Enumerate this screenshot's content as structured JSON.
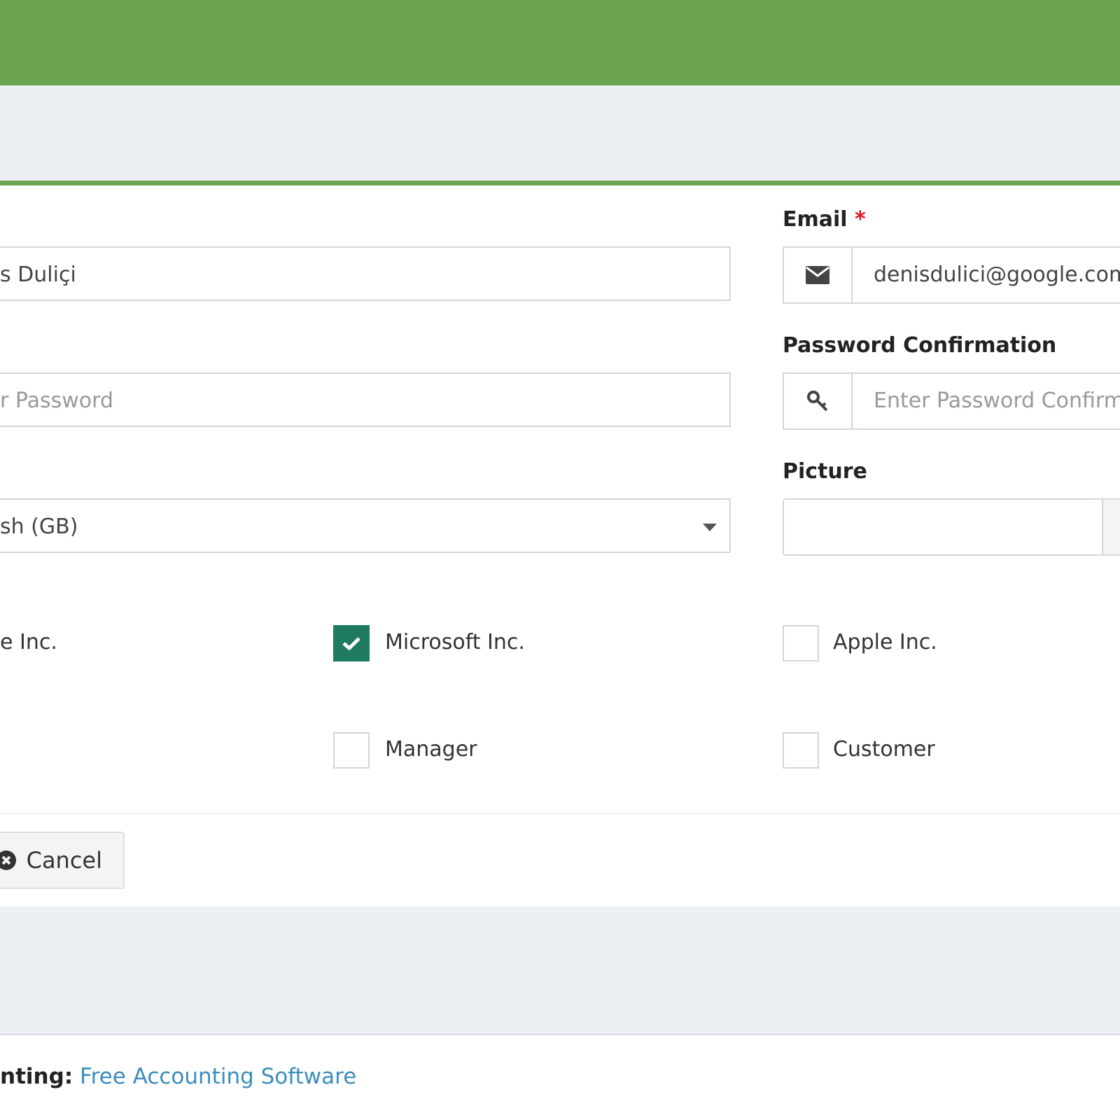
{
  "form": {
    "name": {
      "value": "s Duliçi"
    },
    "email": {
      "label": "Email",
      "required_mark": "*",
      "value": "denisdulici@google.com",
      "icon": "envelope-icon"
    },
    "password": {
      "placeholder": "r Password"
    },
    "password_confirmation": {
      "label": "Password Confirmation",
      "placeholder": "Enter Password Confirma",
      "icon": "key-icon"
    },
    "language": {
      "selected": "sh (GB)"
    },
    "picture": {
      "label": "Picture"
    }
  },
  "companies": [
    {
      "label": "e Inc.",
      "checked": false
    },
    {
      "label": "Microsoft Inc.",
      "checked": true
    },
    {
      "label": "Apple Inc.",
      "checked": false
    }
  ],
  "roles": [
    {
      "label": "Manager",
      "checked": false
    },
    {
      "label": "Customer",
      "checked": false
    }
  ],
  "actions": {
    "cancel_label": "Cancel",
    "cancel_icon": "times-circle-icon"
  },
  "footer": {
    "prefix": "nting:",
    "link_text": "Free Accounting Software"
  },
  "colors": {
    "brand_green": "#6ca551",
    "checkbox_checked": "#1f7b5f",
    "required_red": "#e0141f",
    "link_blue": "#3c8dbc",
    "content_bg": "#ecf0f5"
  }
}
